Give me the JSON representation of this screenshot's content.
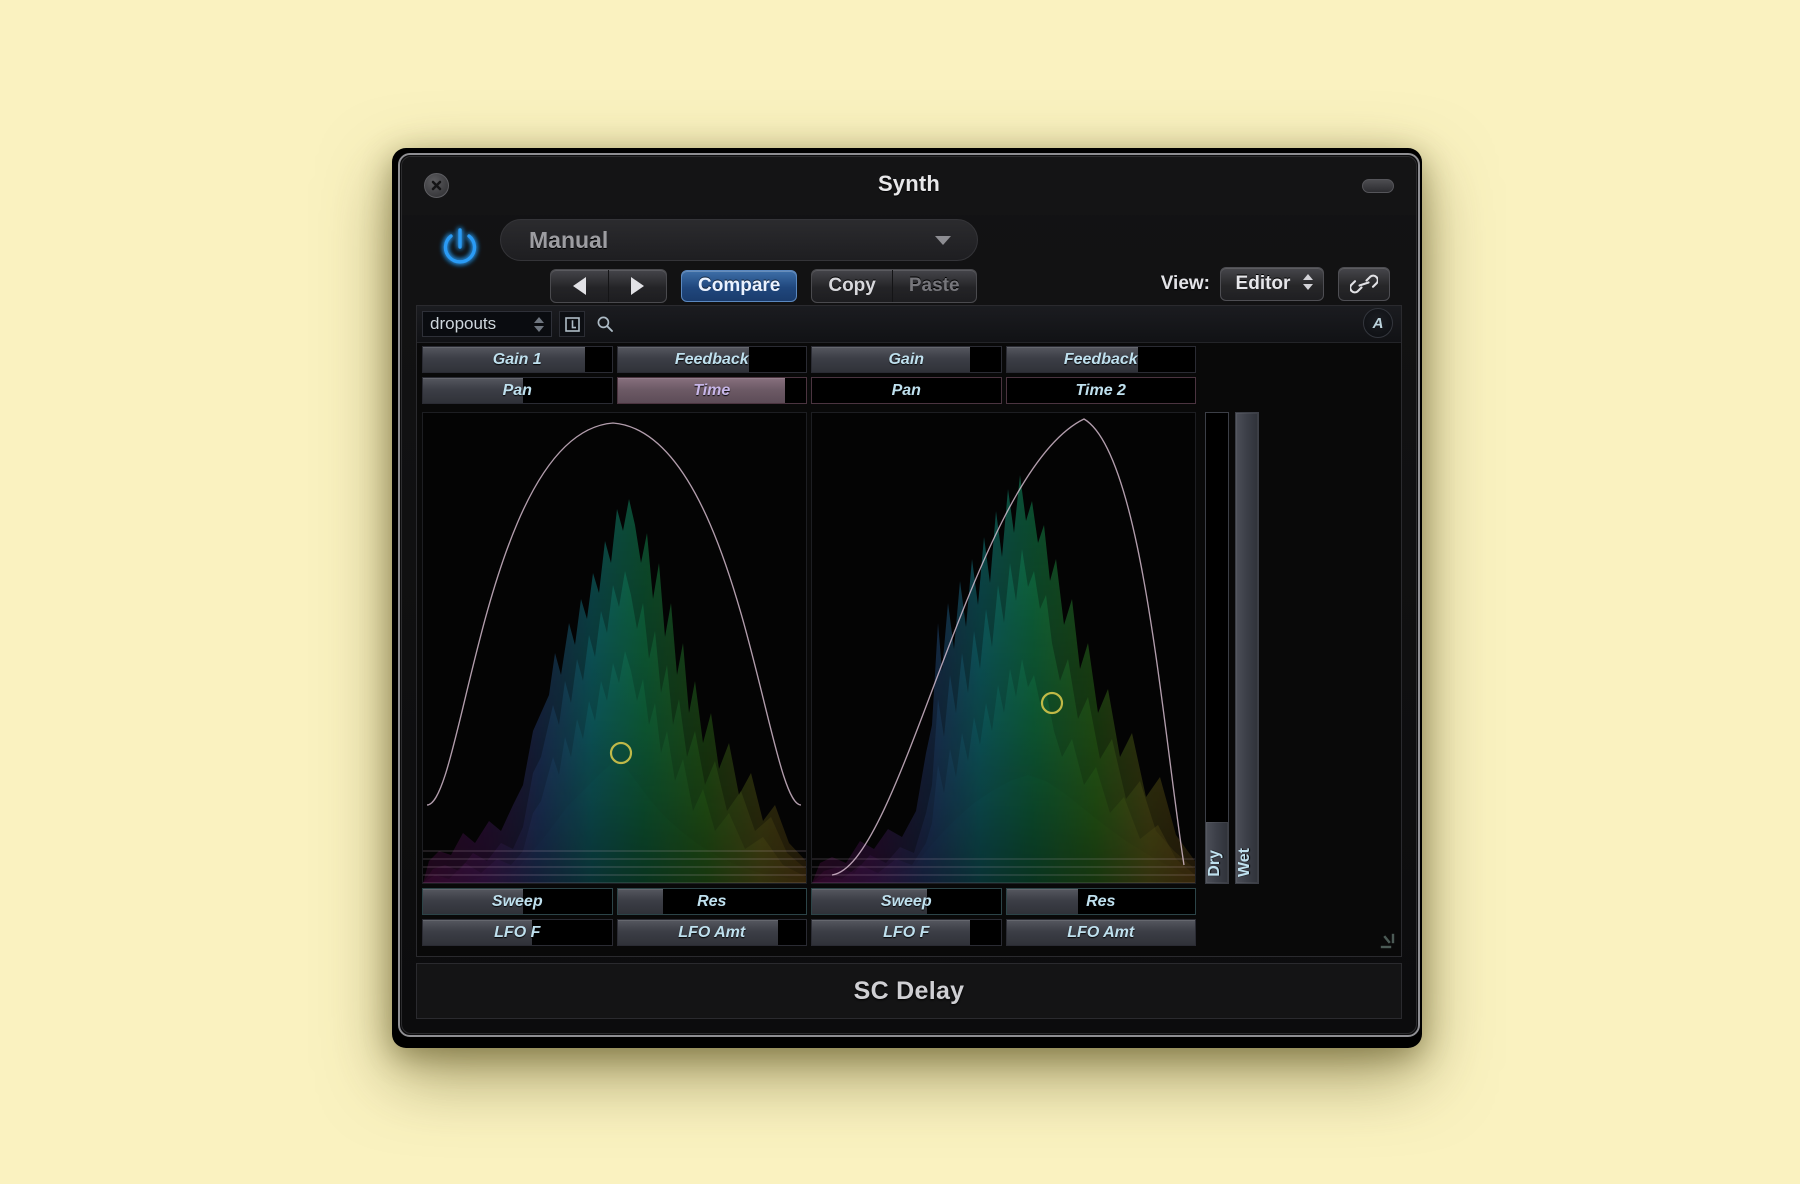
{
  "window": {
    "title": "Synth",
    "close_icon": "close-icon",
    "collapse_icon": "collapse-pill-icon",
    "power_icon": "power-icon"
  },
  "header": {
    "preset_value": "Manual",
    "preset_caret_icon": "chevron-down-icon",
    "prev_icon": "prev-triangle-icon",
    "next_icon": "next-triangle-icon",
    "compare_label": "Compare",
    "copy_label": "Copy",
    "paste_label": "Paste",
    "view_label": "View:",
    "view_value": "Editor",
    "view_stepper_icon": "stepper-updown-icon",
    "link_icon": "link-chain-icon"
  },
  "toolstrip": {
    "preset_name": "dropouts",
    "name_stepper_icon": "stepper-updown-icon",
    "bookmark_icon": "page-flip-icon",
    "search_icon": "search-icon",
    "automation_badge": "A"
  },
  "panels": {
    "left": {
      "top_params": [
        {
          "label": "Gain 1",
          "fill": 86,
          "style": "normal"
        },
        {
          "label": "Feedback",
          "fill": 70,
          "style": "normal"
        },
        {
          "label": "Pan",
          "fill": 53,
          "style": "normal"
        },
        {
          "label": "Time",
          "fill": 89,
          "style": "mauve"
        }
      ],
      "bottom_params": [
        {
          "label": "Sweep",
          "fill": 53,
          "style": "normal"
        },
        {
          "label": "Res",
          "fill": 24,
          "style": "normal"
        },
        {
          "label": "LFO F",
          "fill": 58,
          "style": "normal"
        },
        {
          "label": "LFO Amt",
          "fill": 85,
          "style": "normal"
        }
      ]
    },
    "right": {
      "top_params": [
        {
          "label": "Gain",
          "fill": 84,
          "style": "normal"
        },
        {
          "label": "Feedback",
          "fill": 70,
          "style": "normal"
        },
        {
          "label": "Pan",
          "fill": 0,
          "style": "normal"
        },
        {
          "label": "Time 2",
          "fill": 0,
          "style": "normal"
        }
      ],
      "bottom_params": [
        {
          "label": "Sweep",
          "fill": 61,
          "style": "normal"
        },
        {
          "label": "Res",
          "fill": 38,
          "style": "normal"
        },
        {
          "label": "LFO F",
          "fill": 84,
          "style": "normal"
        },
        {
          "label": "LFO Amt",
          "fill": 100,
          "style": "normal"
        }
      ]
    }
  },
  "mix": {
    "dry_label": "Dry",
    "dry_fill": 13,
    "wet_label": "Wet",
    "wet_fill": 100,
    "resize_grip_icon": "resize-grip-icon"
  },
  "footer": {
    "plugin_name": "SC Delay"
  },
  "colors": {
    "accent_blue": "#2f63a8",
    "power_glow": "#2196f3",
    "param_text": "#bfe0ee",
    "mauve_fill": "#87707e",
    "cursor_yellow": "#cfc24a",
    "page_background": "#faf2c0"
  },
  "chart_data": [
    {
      "type": "area",
      "title": "Left spectrum waterfall display",
      "curve_peak_x_pct": 43,
      "cursor": {
        "x_pct": 52,
        "y_pct": 72
      },
      "legend": [],
      "grid": false
    },
    {
      "type": "area",
      "title": "Right spectrum waterfall display",
      "curve_peak_x_pct": 72,
      "cursor": {
        "x_pct": 64,
        "y_pct": 62
      },
      "legend": [],
      "grid": false
    }
  ]
}
